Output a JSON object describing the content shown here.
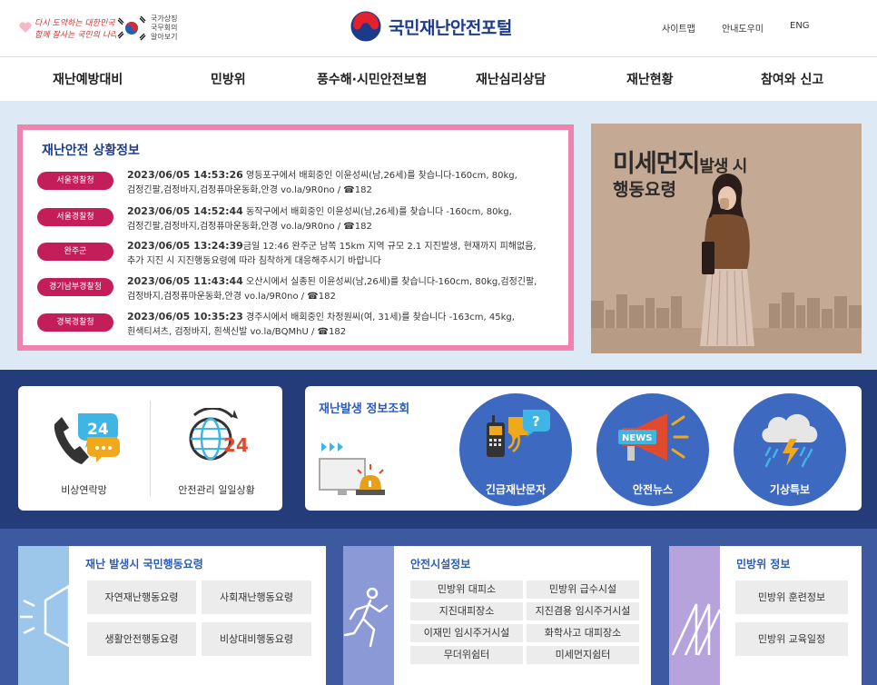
{
  "header": {
    "slogan_line1": "다시 도약하는 대한민국",
    "slogan_line2": "함께 잘사는 국민의 나라",
    "flag_text_1": "국가상징",
    "flag_text_2": "국무회의",
    "flag_text_3": "알아보기",
    "site_title": "국민재난안전포털",
    "util": [
      "사이트맵",
      "안내도우미",
      "ENG"
    ]
  },
  "nav": [
    "재난예방대비",
    "민방위",
    "풍수해·시민안전보험",
    "재난심리상담",
    "재난현황",
    "참여와 신고"
  ],
  "situation": {
    "title": "재난안전 상황정보",
    "items": [
      {
        "badge": "서울경찰청",
        "datetime": "2023/06/05 14:53:26",
        "line1": " 영등포구에서 배회중인 이윤성씨(남,26세)를 찾습니다-160cm, 80kg,",
        "line2": "검정긴팔,검정바지,검정퓨마운동화,안경 vo.la/9R0no / ☎182"
      },
      {
        "badge": "서울경찰청",
        "datetime": "2023/06/05 14:52:44",
        "line1": " 동작구에서 배회중인 이윤성씨(남,26세)를 찾습니다 -160cm, 80kg,",
        "line2": "검정긴팔,검정바지,검정퓨마운동화,안경 vo.la/9R0no / ☎182"
      },
      {
        "badge": "완주군",
        "datetime": "2023/06/05 13:24:39",
        "line1": "금일 12:46 완주군 남쪽 15km 지역 규모 2.1 지진발생, 현재까지 피해없음,",
        "line2": "추가 지진 시 지진행동요령에 따라 침착하게 대응해주시기 바랍니다"
      },
      {
        "badge": "경기남부경찰청",
        "datetime": "2023/06/05 11:43:44",
        "line1": " 오산시에서 실종된 이윤성씨(남,26세)를 찾습니다-160cm, 80kg,검정긴팔,",
        "line2": "검정바지,검정퓨마운동화,안경 vo.la/9R0no / ☎182"
      },
      {
        "badge": "경북경찰청",
        "datetime": "2023/06/05 10:35:23",
        "line1": " 경주시에서 배회중인 차정원씨(여, 31세)를 찾습니다 -163cm, 45kg,",
        "line2": "흰색티셔츠, 검정바지, 흰색신발 vo.la/BQMhU / ☎182"
      }
    ]
  },
  "poster": {
    "title_big": "미세먼지",
    "title_small": "발생 시",
    "title_line2": "행동요령"
  },
  "quick": [
    {
      "label": "비상연락망",
      "badge": "24"
    },
    {
      "label": "안전관리 일일상황",
      "badge": "24"
    }
  ],
  "inquiry": {
    "title": "재난발생 정보조회",
    "circles": [
      "긴급재난문자",
      "안전뉴스",
      "기상특보"
    ],
    "news_text": "NEWS"
  },
  "panels": [
    {
      "title": "재난 발생시 국민행동요령",
      "buttons": [
        "자연재난행동요령",
        "사회재난행동요령",
        "생활안전행동요령",
        "비상대비행동요령"
      ]
    },
    {
      "title": "안전시설정보",
      "buttons": [
        "민방위 대피소",
        "민방위 급수시설",
        "지진대피장소",
        "지진겸용 임시주거시설",
        "이재민 임시주거시설",
        "화학사고 대피장소",
        "무더위쉼터",
        "미세먼지쉼터"
      ]
    },
    {
      "title": "민방위 정보",
      "buttons": [
        "민방위 훈련정보",
        "민방위 교육일정"
      ]
    }
  ],
  "colors": {
    "primary": "#1f3c88",
    "accent": "#c41e5a",
    "band": "#253c7b",
    "circle": "#3e69c0"
  }
}
